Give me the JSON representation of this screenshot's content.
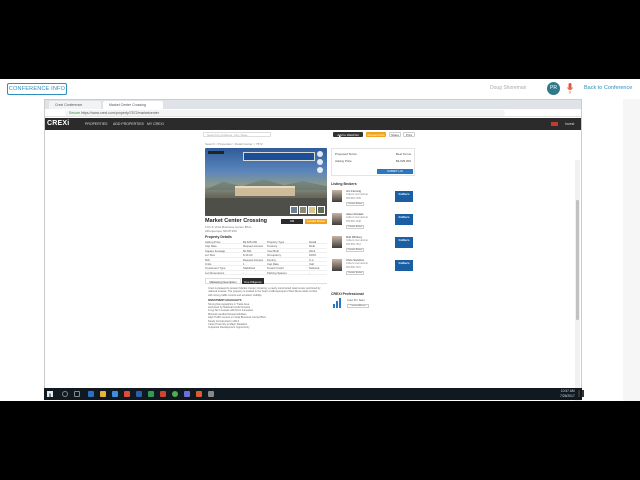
{
  "conference": {
    "info_button": "CONFERENCE INFO",
    "presenter_name": "Doug Shoreman",
    "avatar_initials": "PR",
    "back_link": "Back to Conference"
  },
  "browser": {
    "tabs": [
      "Crexi Conference",
      "Market Center Crossing"
    ],
    "address_secure": "Secure",
    "address_url": "https://www.crexi.com/property/7572/marketcenter"
  },
  "crexi_nav": {
    "logo": "CREXi",
    "items": [
      "PROPERTIES",
      "ADD PROPERTIES",
      "MY CREXI"
    ],
    "user": "Invest"
  },
  "page": {
    "search_placeholder": "Search by Address, City, State",
    "actions": [
      "Add to Watchlist",
      "Request Info",
      "Share",
      "Print"
    ],
    "breadcrumb": "Search > Properties > Retail Center > 7572",
    "title": "Market Center Crossing",
    "subtitle": "17th & Vista Business Center Blvd., Albuquerque NM 87109",
    "om_button": "OM",
    "cta_button": "Contact Broker",
    "details_heading": "Property Details",
    "details": [
      [
        "Asking Price",
        "$9,625,000",
        "Property Type",
        "Retail"
      ],
      [
        "Cap Rate",
        "Request Access",
        "Tenancy",
        "Multi"
      ],
      [
        "Square Footage",
        "60,551",
        "Year Built",
        "2014"
      ],
      [
        "Lot Size",
        "8.40 AC",
        "Occupancy",
        "100%"
      ],
      [
        "NOI",
        "Request Access",
        "Zoning",
        "C-2"
      ],
      [
        "Units",
        "1",
        "Cap Rate",
        "Call"
      ],
      [
        "Investment Type",
        "Stabilized",
        "Tenant Credit",
        "National"
      ],
      [
        "Lot Dimensions",
        "-",
        "Parking Spaces",
        "-"
      ]
    ],
    "tabs": [
      "Marketing Description",
      "Due Diligence"
    ],
    "description": "Crexi is pleased to present Market Center Crossing, a newly constructed retail center anchored by national tenants. The property is located in the heart of Albuquerque's West Mesa retail corridor with strong traffic counts and excellent visibility.",
    "highlights_heading": "INVESTMENT HIGHLIGHTS",
    "highlights": [
      "Strong Demographics in Trade Area",
      "Anchored by National Credit Tenants",
      "Long-Term Leases with Rent Increases",
      "Minimal Landlord Responsibilities",
      "High Traffic Counts on Vista Business Center Blvd.",
      "Newly Constructed in 2014",
      "Close Proximity to Major Retailers",
      "Outparcel Development Opportunity"
    ]
  },
  "panel": {
    "proposed_terms_label": "Proposed Terms",
    "proposed_terms_value": "Best Terms",
    "asking_price_label": "Asking Price",
    "asking_price_value": "$9,625,000",
    "submit_button": "SUBMIT LOI",
    "updated": "Updated: 8/7/2017"
  },
  "brokers": {
    "heading": "Listing Brokers",
    "items": [
      {
        "name": "Jim Fleming",
        "info1": "Colliers International",
        "info2": "505-880-7035",
        "button": "Contact Broker",
        "logo": "Colliers"
      },
      {
        "name": "Jason Daniels",
        "info1": "Colliers International",
        "info2": "505-880-7048",
        "button": "Contact Broker",
        "logo": "Colliers"
      },
      {
        "name": "Rob Whitney",
        "info1": "Colliers International",
        "info2": "505-880-7012",
        "button": "Contact Broker",
        "logo": "Colliers"
      },
      {
        "name": "Chris Sanchez",
        "info1": "Colliers International",
        "info2": "505-880-7021",
        "button": "Contact Broker",
        "logo": "Colliers"
      }
    ]
  },
  "pro": {
    "heading": "CREXi Professional",
    "name": "Crexi Pro Team",
    "button": "Contact Advisor"
  },
  "taskbar": {
    "time": "10:57 AM",
    "date": "7/26/2017"
  },
  "colors": {
    "accent": "#2d8fbd",
    "brand_orange": "#f2a31b",
    "nav_dark": "#2b2b2b"
  }
}
